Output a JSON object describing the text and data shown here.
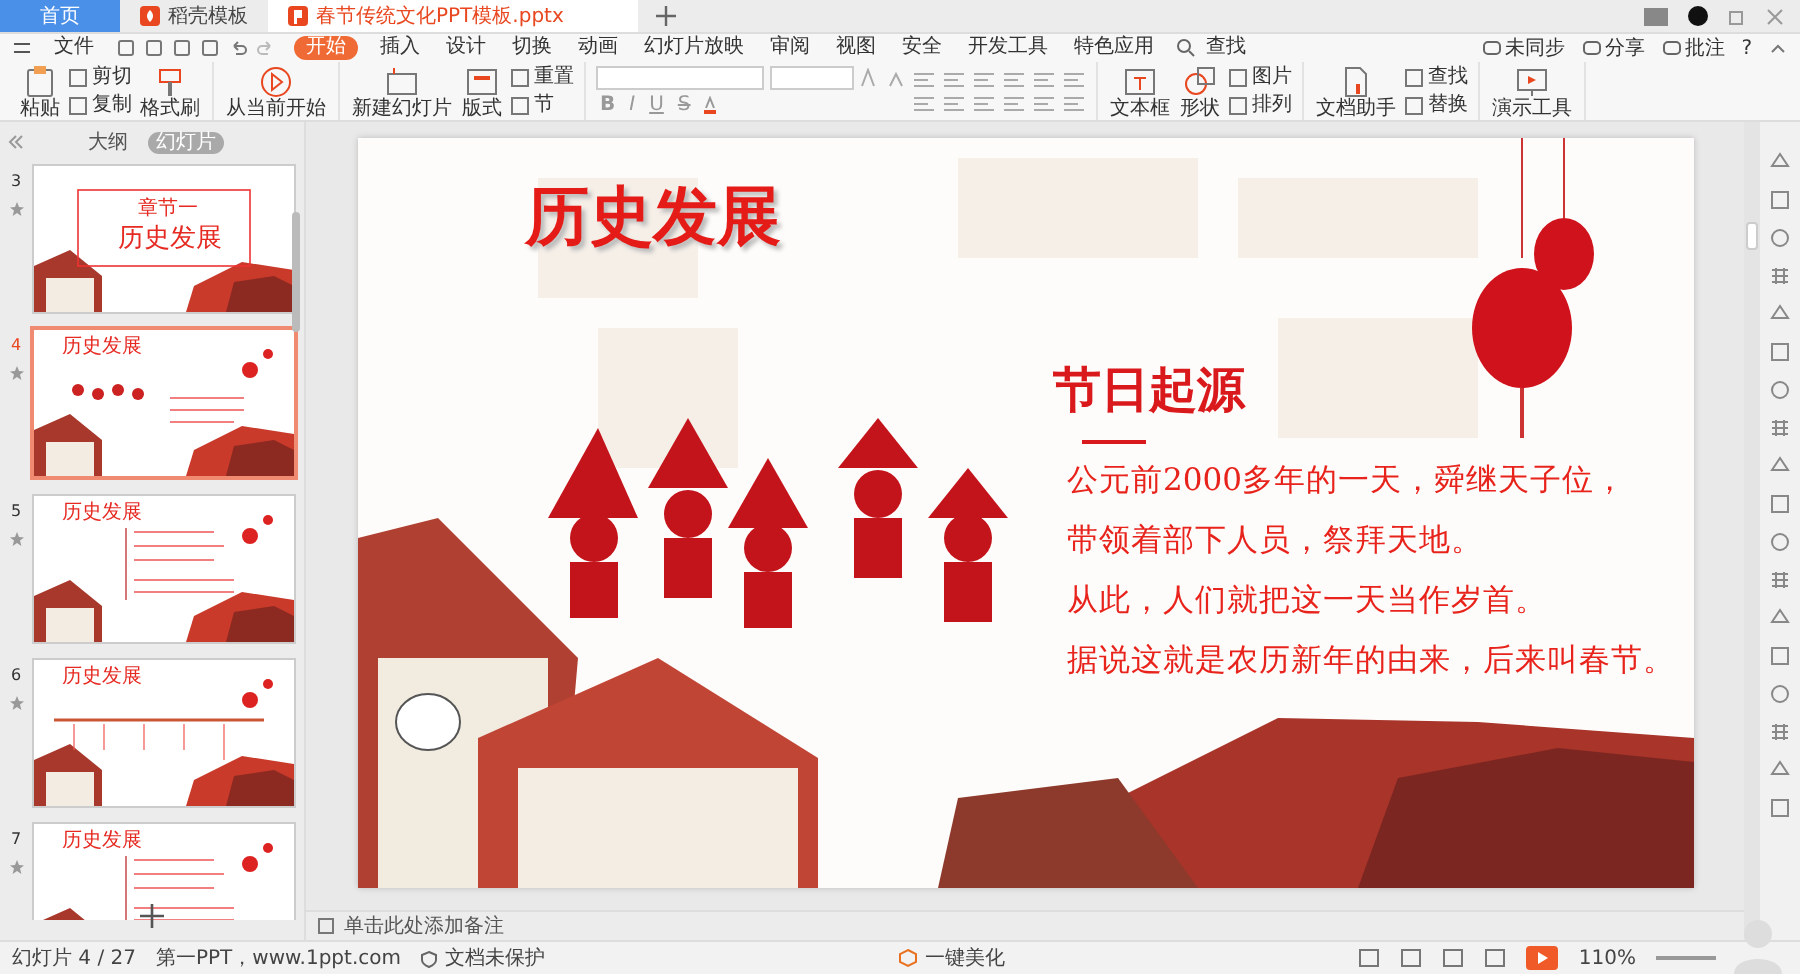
{
  "tabs": [
    {
      "label": "首页",
      "kind": "home",
      "selected": false
    },
    {
      "label": "稻壳模板",
      "kind": "store",
      "selected": false
    },
    {
      "label": "春节传统文化PPT模板.pptx",
      "kind": "file",
      "selected": true
    }
  ],
  "menu": [
    {
      "label": "文件",
      "selected": false
    },
    {
      "label": "开始",
      "selected": true
    },
    {
      "label": "插入",
      "selected": false
    },
    {
      "label": "设计",
      "selected": false
    },
    {
      "label": "切换",
      "selected": false
    },
    {
      "label": "动画",
      "selected": false
    },
    {
      "label": "幻灯片放映",
      "selected": false
    },
    {
      "label": "审阅",
      "selected": false
    },
    {
      "label": "视图",
      "selected": false
    },
    {
      "label": "安全",
      "selected": false
    },
    {
      "label": "开发工具",
      "selected": false
    },
    {
      "label": "特色应用",
      "selected": false
    },
    {
      "label": "查找",
      "selected": false
    }
  ],
  "menu_right": [
    "未同步",
    "分享",
    "批注",
    "?"
  ],
  "ribbon": [
    {
      "label": "粘贴",
      "kind": "large"
    },
    {
      "label": "剪切",
      "kind": "small"
    },
    {
      "label": "复制",
      "kind": "small"
    },
    {
      "label": "格式刷",
      "kind": "large"
    },
    {
      "label": "从当前开始",
      "kind": "large"
    },
    {
      "label": "新建幻灯片",
      "kind": "large"
    },
    {
      "label": "版式",
      "kind": "large"
    },
    {
      "label": "重置",
      "kind": "small"
    },
    {
      "label": "节",
      "kind": "small"
    },
    {
      "kind": "fonts"
    },
    {
      "label": "文本框",
      "kind": "large"
    },
    {
      "label": "形状",
      "kind": "large"
    },
    {
      "label": "图片",
      "kind": "small"
    },
    {
      "label": "排列",
      "kind": "small"
    },
    {
      "label": "文档助手",
      "kind": "large"
    },
    {
      "label": "查找",
      "kind": "small"
    },
    {
      "label": "替换",
      "kind": "small"
    },
    {
      "label": "演示工具",
      "kind": "large"
    }
  ],
  "format_buttons": [
    "B",
    "I",
    "U",
    "S"
  ],
  "panel_tabs": [
    {
      "label": "大纲",
      "selected": false
    },
    {
      "label": "幻灯片",
      "selected": true
    }
  ],
  "thumbnails": [
    {
      "number": "3",
      "kind": "chapter",
      "selected": false,
      "texts": [
        "章节一",
        "历史发展"
      ]
    },
    {
      "number": "4",
      "kind": "content",
      "selected": true,
      "texts": [
        "历史发展"
      ]
    },
    {
      "number": "5",
      "kind": "list",
      "selected": false,
      "texts": [
        "历史发展"
      ]
    },
    {
      "number": "6",
      "kind": "timeline",
      "selected": false,
      "texts": [
        "历史发展"
      ]
    },
    {
      "number": "7",
      "kind": "list",
      "selected": false,
      "texts": [
        "历史发展"
      ]
    }
  ],
  "slide": {
    "title": "历史发展",
    "heading": "节日起源",
    "lines": [
      "公元前2000多年的一天，舜继天子位，",
      "带领着部下人员，祭拜天地。",
      "从此，人们就把这一天当作岁首。",
      "据说这就是农历新年的由来，后来叫春节。"
    ]
  },
  "notes_placeholder": "单击此处添加备注",
  "status": {
    "slide_counter": "幻灯片 4 / 27",
    "theme": "第一PPT，www.1ppt.com",
    "protection": "文档未保护",
    "beautify": "一键美化",
    "zoom": "110%"
  }
}
